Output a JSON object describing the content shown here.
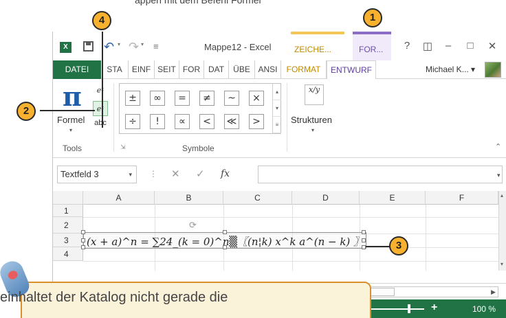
{
  "top_caption": "appen mit dem Befehl Formel   ",
  "app": {
    "title": "Mappe12 - Excel",
    "icon_text": "X",
    "context_tabs": [
      "ZEICHE...",
      "FOR..."
    ],
    "window_controls": [
      "?",
      "◫",
      "–",
      "□",
      "✕"
    ]
  },
  "tabs": [
    "DATEI",
    "STA",
    "EINF",
    "SEIT",
    "FOR",
    "DAT",
    "ÜBE",
    "ANSI",
    "FORMAT",
    "ENTWURF"
  ],
  "active_tab": "ENTWURF",
  "user": {
    "name": "Michael K... ▾"
  },
  "ribbon": {
    "tools": {
      "big_button_icon": "π",
      "big_button_label": "Formel",
      "small_buttons": [
        "eˣ",
        "eˣ",
        "abc"
      ],
      "group_label": "Tools"
    },
    "symbole": {
      "symbols": [
        "±",
        "∞",
        "=",
        "≠",
        "~",
        "×",
        "÷",
        "!",
        "∝",
        "<",
        "≪",
        ">"
      ],
      "group_label": "Symbole"
    },
    "strukturen": {
      "icon": "x/y",
      "label": "Strukturen"
    }
  },
  "formula_bar": {
    "name_box": "Textfeld 3",
    "fx": "fx",
    "cancel": "✕",
    "confirm": "✓"
  },
  "grid": {
    "columns": [
      "A",
      "B",
      "C",
      "D",
      "E",
      "F"
    ],
    "rows": [
      "1",
      "2",
      "3",
      "4"
    ]
  },
  "equation": "(x + a)^n = ∑24_(k = 0)^n▒〖(n¦k) x^k a^(n − k) 〗",
  "zoom": {
    "label": "100 %",
    "level_percent": 100
  },
  "callouts": [
    "1",
    "2",
    "3",
    "4"
  ],
  "note": {
    "text": "einhaltet der Katalog nicht gerade die"
  },
  "icons": {
    "pi": "pi-icon",
    "structure": "fraction-icon",
    "mouse": "mouse-icon"
  }
}
